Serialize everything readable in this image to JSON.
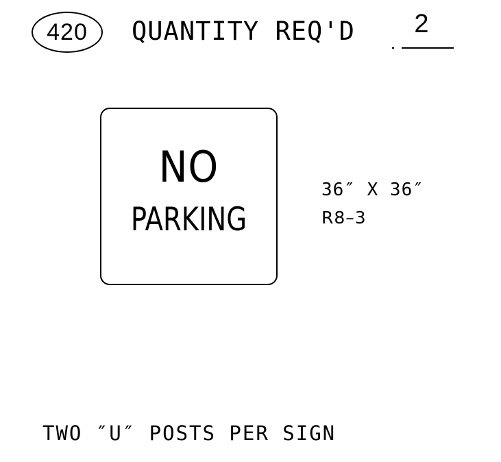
{
  "header": {
    "item_number": "420",
    "quantity_label": "QUANTITY REQ'D",
    "quantity_value": "2"
  },
  "sign": {
    "line1": "NO",
    "line2": "PARKING",
    "size": "36″ X 36″",
    "code": "R8–3"
  },
  "notes": {
    "posts": "TWO ″U″ POSTS PER SIGN"
  }
}
